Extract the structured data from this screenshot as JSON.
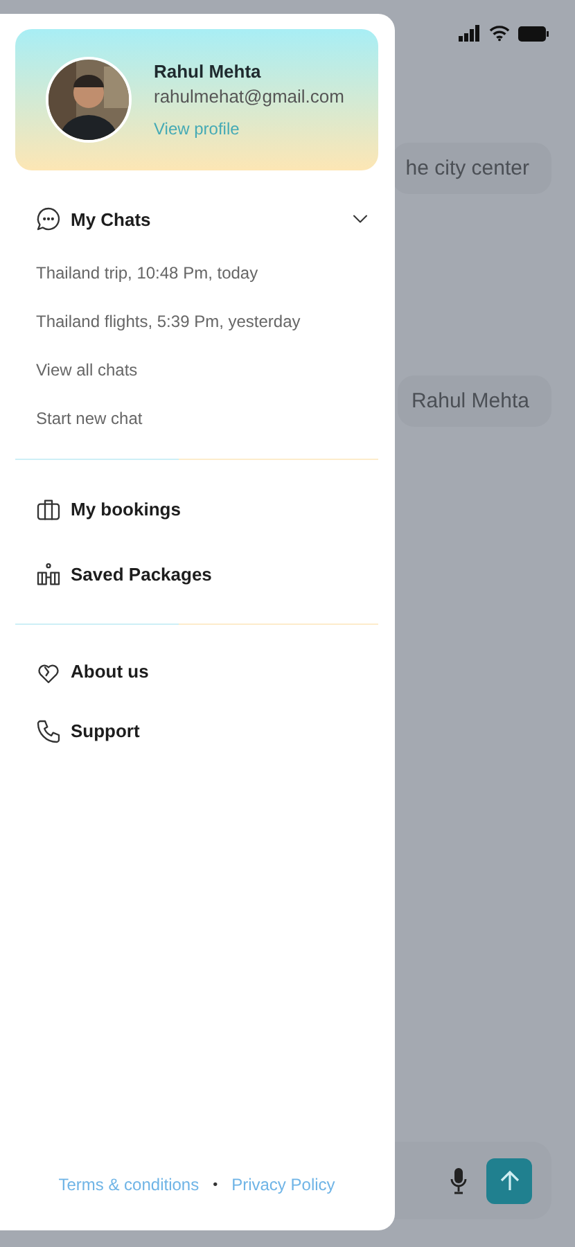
{
  "background_chat": {
    "messages": [
      {
        "text": "he city center"
      },
      {
        "text": "Rahul Mehta"
      }
    ]
  },
  "drawer": {
    "profile": {
      "name": "Rahul Mehta",
      "email": "rahulmehat@gmail.com",
      "link": "View profile"
    },
    "chats": {
      "title": "My Chats",
      "expanded": true,
      "items": [
        {
          "label": "Thailand trip, 10:48 Pm, today"
        },
        {
          "label": "Thailand flights, 5:39 Pm, yesterday"
        },
        {
          "label": "View all chats"
        },
        {
          "label": "Start new chat"
        }
      ]
    },
    "sections": [
      [
        {
          "label": "My bookings",
          "kind": "suitcase"
        },
        {
          "label": "Saved Packages",
          "kind": "packages"
        }
      ],
      [
        {
          "label": "About us",
          "kind": "heart"
        },
        {
          "label": "Support",
          "kind": "phone"
        }
      ]
    ],
    "footer": {
      "links": [
        "Terms & conditions",
        "Privacy Policy"
      ],
      "separator": "•"
    }
  }
}
